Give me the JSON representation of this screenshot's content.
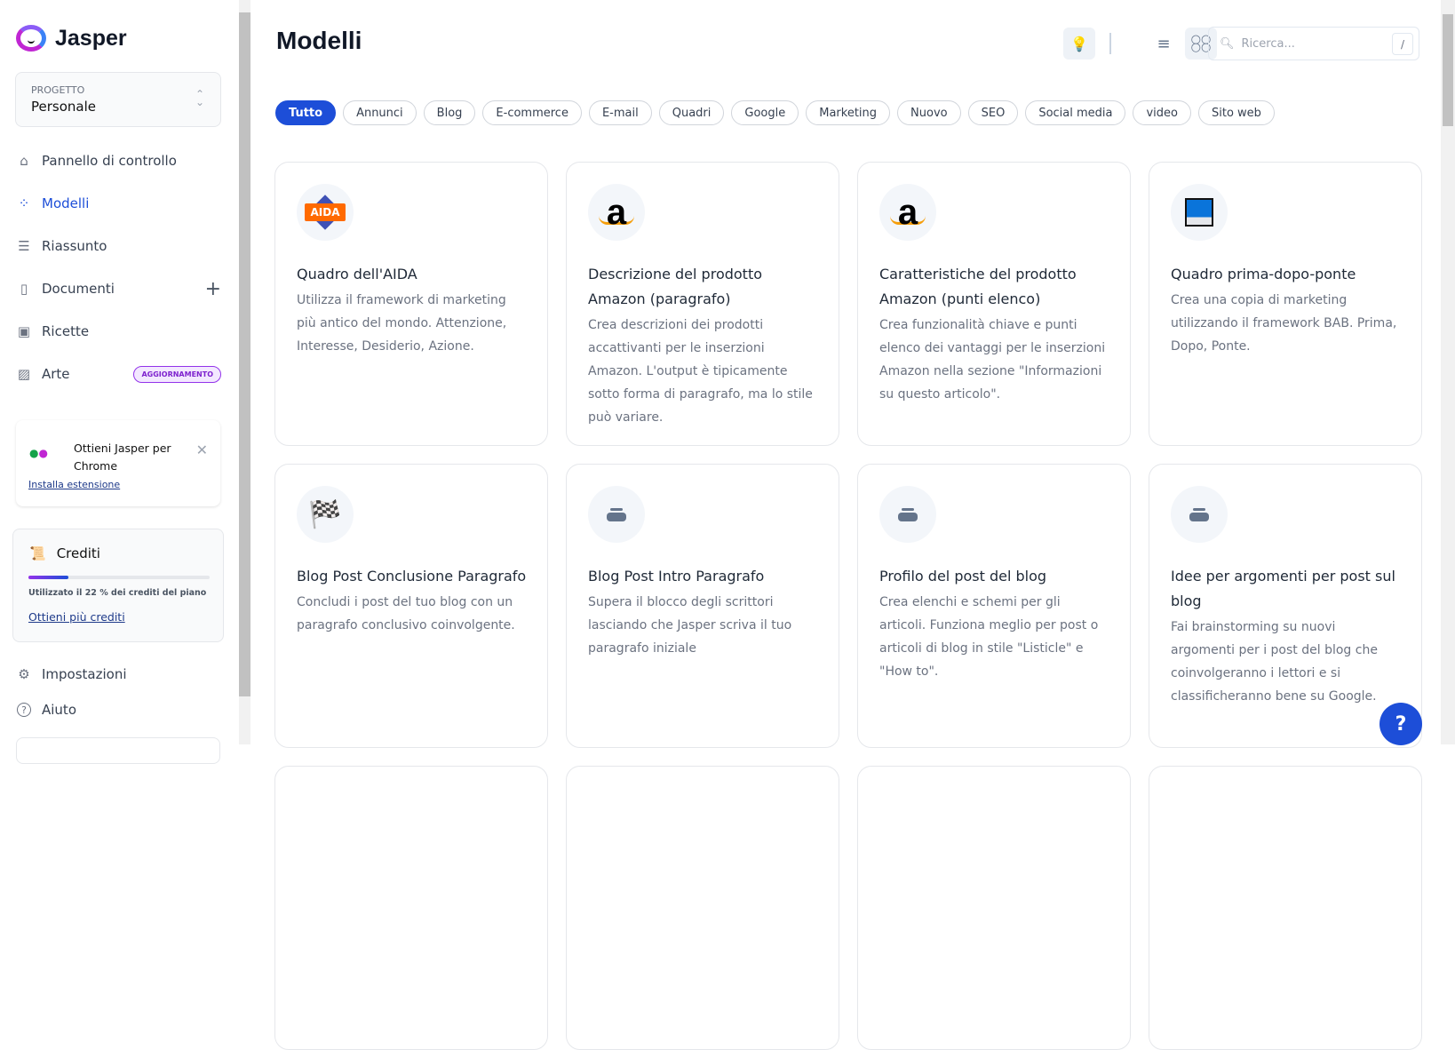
{
  "app": {
    "name": "Jasper"
  },
  "project": {
    "label": "PROGETTO",
    "value": "Personale"
  },
  "nav": [
    {
      "label": "Pannello di controllo",
      "icon": "home-icon"
    },
    {
      "label": "Modelli",
      "icon": "grid-icon",
      "active": true
    },
    {
      "label": "Riassunto",
      "icon": "list-icon"
    },
    {
      "label": "Documenti",
      "icon": "document-icon"
    },
    {
      "label": "Ricette",
      "icon": "terminal-icon"
    },
    {
      "label": "Arte",
      "icon": "image-icon",
      "badge": "AGGIORNAMENTO"
    }
  ],
  "chrome_promo": {
    "text": "Ottieni Jasper per Chrome",
    "link": "Installa estensione"
  },
  "credits": {
    "title": "Crediti",
    "used_percent": 22,
    "usage_text": "Utilizzato il 22 % dei crediti del piano",
    "link": "Ottieni più crediti"
  },
  "footer_nav": [
    {
      "label": "Impostazioni",
      "icon": "gear-icon"
    },
    {
      "label": "Aiuto",
      "icon": "help-circle-icon"
    }
  ],
  "header": {
    "title": "Modelli",
    "search_placeholder": "Ricerca...",
    "search_shortcut": "/"
  },
  "filters": [
    "Tutto",
    "Annunci",
    "Blog",
    "E-commerce",
    "E-mail",
    "Quadri",
    "Google",
    "Marketing",
    "Nuovo",
    "SEO",
    "Social media",
    "video",
    "Sito web"
  ],
  "active_filter": "Tutto",
  "accent": "#1d4ed8",
  "cards": [
    {
      "title": "Quadro dell'AIDA",
      "desc": "Utilizza il framework di marketing più antico del mondo. Attenzione, Interesse, Desiderio, Azione.",
      "icon": "aida-icon",
      "logo_text": "AIDA"
    },
    {
      "title": "Descrizione del prodotto Amazon (paragrafo)",
      "desc": "Crea descrizioni dei prodotti accattivanti per le inserzioni Amazon. L'output è tipicamente sotto forma di paragrafo, ma lo stile può variare.",
      "icon": "amazon-icon"
    },
    {
      "title": "Caratteristiche del prodotto Amazon (punti elenco)",
      "desc": "Crea funzionalità chiave e punti elenco dei vantaggi per le inserzioni Amazon nella sezione \"Informazioni su questo articolo\".",
      "icon": "amazon-icon"
    },
    {
      "title": "Quadro prima-dopo-ponte",
      "desc": "Crea una copia di marketing utilizzando il framework BAB. Prima, Dopo, Ponte.",
      "icon": "bridge-icon"
    },
    {
      "title": "Blog Post Conclusione Paragrafo",
      "desc": "Concludi i post del tuo blog con un paragrafo conclusivo coinvolgente.",
      "icon": "checkered-flag-icon"
    },
    {
      "title": "Blog Post Intro Paragrafo",
      "desc": "Supera il blocco degli scrittori lasciando che Jasper scriva il tuo paragrafo iniziale",
      "icon": "stack-icon"
    },
    {
      "title": "Profilo del post del blog",
      "desc": "Crea elenchi e schemi per gli articoli. Funziona meglio per post o articoli di blog in stile \"Listicle\" e \"How to\".",
      "icon": "stack-icon"
    },
    {
      "title": "Idee per argomenti per post sul blog",
      "desc": "Fai brainstorming su nuovi argomenti per i post del blog che coinvolgeranno i lettori e si classificheranno bene su Google.",
      "icon": "stack-icon"
    }
  ],
  "help_button": "?"
}
